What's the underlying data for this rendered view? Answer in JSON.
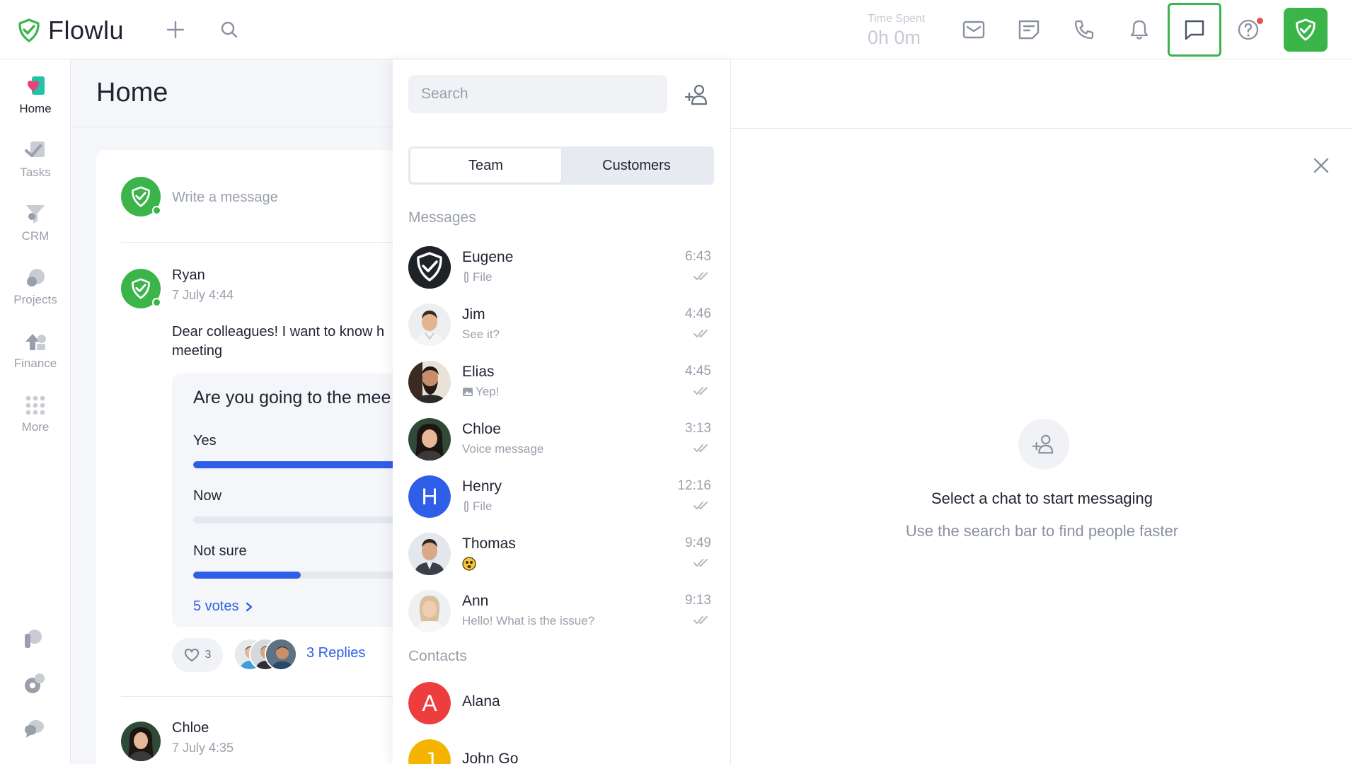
{
  "app": {
    "name": "Flowlu",
    "brand_color": "#3bb54a",
    "accent_color": "#2f5ee8"
  },
  "topbar": {
    "time_spent_label": "Time Spent",
    "time_spent_value": "0h 0m",
    "icons": [
      "plus-icon",
      "search-icon",
      "mail-icon",
      "notes-icon",
      "phone-icon",
      "bell-icon",
      "chat-icon",
      "help-icon"
    ]
  },
  "leftnav": {
    "items": [
      {
        "label": "Home",
        "icon": "home-icon"
      },
      {
        "label": "Tasks",
        "icon": "tasks-icon"
      },
      {
        "label": "CRM",
        "icon": "crm-icon"
      },
      {
        "label": "Projects",
        "icon": "projects-icon"
      },
      {
        "label": "Finance",
        "icon": "finance-icon"
      },
      {
        "label": "More",
        "icon": "more-icon"
      }
    ]
  },
  "home": {
    "title": "Home",
    "write_placeholder": "Write a message",
    "post": {
      "author": "Ryan",
      "date": "7 July 4:44",
      "text_line1": "Dear colleagues! I want to know h",
      "text_line2": "meeting",
      "poll": {
        "question": "Are you going to the mee",
        "options": [
          {
            "label": "Yes",
            "fraction": 1.0
          },
          {
            "label": "Now",
            "fraction": 0.0
          },
          {
            "label": "Not sure",
            "fraction": 0.46
          }
        ],
        "votes": "5 votes"
      },
      "likes": "3",
      "replies": "3 Replies"
    },
    "next_post": {
      "author": "Chloe",
      "date": "7 July 4:35"
    }
  },
  "chat": {
    "search_placeholder": "Search",
    "tabs": {
      "team": "Team",
      "customers": "Customers"
    },
    "messages_title": "Messages",
    "messages": [
      {
        "name": "Eugene",
        "sub": "File",
        "sub_icon": "paperclip-icon",
        "time": "6:43"
      },
      {
        "name": "Jim",
        "sub": "See it?",
        "sub_icon": "",
        "time": "4:46"
      },
      {
        "name": "Elias",
        "sub": "Yep!",
        "sub_icon": "image-icon",
        "time": "4:45"
      },
      {
        "name": "Chloe",
        "sub": "Voice message",
        "sub_icon": "",
        "time": "3:13"
      },
      {
        "name": "Henry",
        "sub": "File",
        "sub_icon": "paperclip-icon",
        "time": "12:16",
        "initial": "H"
      },
      {
        "name": "Thomas",
        "sub": "",
        "sub_icon": "emoji-icon",
        "time": "9:49"
      },
      {
        "name": "Ann",
        "sub": "Hello! What is the issue?",
        "sub_icon": "",
        "time": "9:13"
      }
    ],
    "contacts_title": "Contacts",
    "contacts": [
      {
        "name": "Alana",
        "initial": "A",
        "color": "#ee3d3d"
      },
      {
        "name": "John Go",
        "initial": "J",
        "color": "#f5b400"
      }
    ]
  },
  "empty_state": {
    "title": "Select a chat to start messaging",
    "subtitle": "Use the search bar to find people faster"
  }
}
